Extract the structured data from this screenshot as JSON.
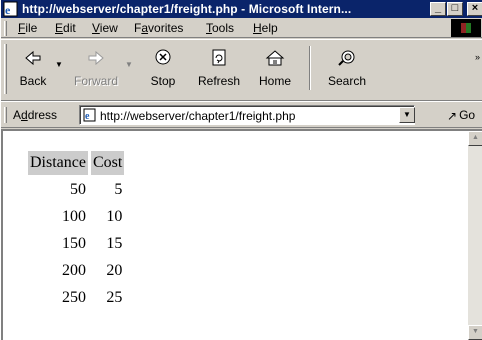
{
  "window": {
    "title": "http://webserver/chapter1/freight.php - Microsoft Intern...",
    "minimize": "_",
    "maximize": "□",
    "close": "×"
  },
  "menu": {
    "items": [
      {
        "key": "F",
        "rest": "ile"
      },
      {
        "key": "E",
        "rest": "dit"
      },
      {
        "key": "V",
        "rest": "iew"
      },
      {
        "pre": "F",
        "key": "a",
        "rest": "vorites"
      },
      {
        "key": "T",
        "rest": "ools"
      },
      {
        "key": "H",
        "rest": "elp"
      }
    ]
  },
  "toolbar": {
    "back": "Back",
    "forward": "Forward",
    "stop": "Stop",
    "refresh": "Refresh",
    "home": "Home",
    "search": "Search",
    "more": "»"
  },
  "address": {
    "label_pre": "A",
    "label_key": "d",
    "label_rest": "dress",
    "url": "http://webserver/chapter1/freight.php",
    "go": "Go"
  },
  "freight_table": {
    "headers": [
      "Distance",
      "Cost"
    ],
    "rows": [
      [
        "50",
        "5"
      ],
      [
        "100",
        "10"
      ],
      [
        "150",
        "15"
      ],
      [
        "200",
        "20"
      ],
      [
        "250",
        "25"
      ]
    ]
  }
}
